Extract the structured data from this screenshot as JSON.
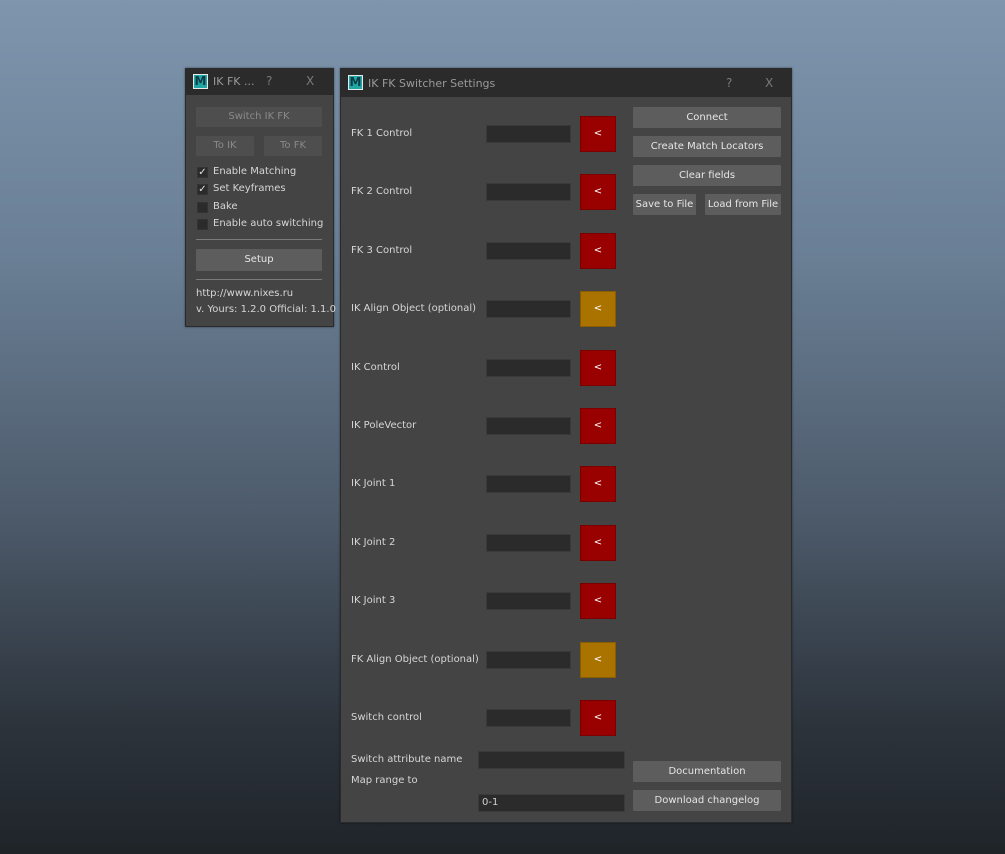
{
  "mini_window": {
    "title": "IK FK ...",
    "help": "?",
    "close": "X",
    "switch_button": "Switch IK FK",
    "to_ik": "To IK",
    "to_fk": "To FK",
    "checkboxes": [
      {
        "label": "Enable Matching",
        "checked": true,
        "mark": "✓"
      },
      {
        "label": "Set Keyframes",
        "checked": true,
        "mark": "✓"
      },
      {
        "label": "Bake",
        "checked": false,
        "mark": ""
      },
      {
        "label": "Enable auto switching",
        "checked": false,
        "mark": ""
      }
    ],
    "setup_button": "Setup",
    "url": "http://www.nixes.ru",
    "version": "v. Yours: 1.2.0 Official: 1.1.0"
  },
  "settings_window": {
    "title": "IK FK Switcher Settings",
    "help": "?",
    "close": "X",
    "pick_label": "<",
    "rows": [
      {
        "label": "FK 1 Control",
        "value": "",
        "color": "#990000"
      },
      {
        "label": "FK 2 Control",
        "value": "",
        "color": "#990000"
      },
      {
        "label": "FK 3 Control",
        "value": "",
        "color": "#990000"
      },
      {
        "label": "IK Align Object (optional)",
        "value": "",
        "color": "#aa7300"
      },
      {
        "label": "IK Control",
        "value": "",
        "color": "#990000"
      },
      {
        "label": "IK PoleVector",
        "value": "",
        "color": "#990000"
      },
      {
        "label": "IK Joint 1",
        "value": "",
        "color": "#990000"
      },
      {
        "label": "IK Joint 2",
        "value": "",
        "color": "#990000"
      },
      {
        "label": "IK Joint 3",
        "value": "",
        "color": "#990000"
      },
      {
        "label": "FK Align Object (optional)",
        "value": "",
        "color": "#aa7300"
      },
      {
        "label": "Switch control",
        "value": "",
        "color": "#990000"
      }
    ],
    "switch_attr_label": "Switch attribute name",
    "switch_attr_value": "",
    "map_range_label": "Map range to",
    "map_range_value": "0-1",
    "buttons": {
      "connect": "Connect",
      "create_locators": "Create Match Locators",
      "clear_fields": "Clear fields",
      "save_to_file": "Save to File",
      "load_from_file": "Load from File",
      "documentation": "Documentation",
      "download_changelog": "Download changelog"
    }
  }
}
